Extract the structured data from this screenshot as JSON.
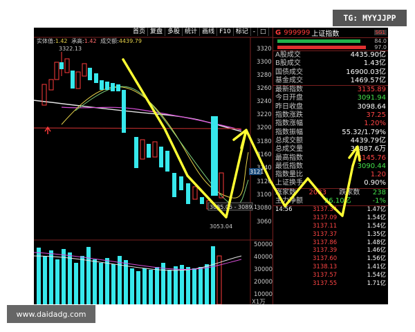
{
  "toolbar": {
    "items": [
      "首页",
      "复盘",
      "多股",
      "统计",
      "画线",
      "F10",
      "标记",
      "-",
      "□"
    ]
  },
  "legend": {
    "label1": "实体值:",
    "val1": "1.42",
    "label2": "承高:",
    "val2": "1.42",
    "label3": "成交额:",
    "val3": "4439.79"
  },
  "price_axis": {
    "ticks": [
      "3320",
      "3300",
      "3280",
      "3260",
      "3240",
      "3220",
      "3200",
      "3180",
      "3160",
      "3140",
      "3120",
      "3100",
      "3080",
      "3060"
    ]
  },
  "vol_axis": {
    "ticks": [
      "50000",
      "40000",
      "30000",
      "20000",
      "10000"
    ],
    "unit": "X1万"
  },
  "annotations": {
    "high": "3322.13",
    "low": "3053.04",
    "last_range": "3085.05 - 3089.1",
    "side_price": "3121"
  },
  "sidebar": {
    "g": "G",
    "code": "999999",
    "name": "上证指数",
    "sg": "SG1",
    "bar1_pct": "84.0",
    "bar2_pct": "97.0",
    "rows1": [
      {
        "k": "A股成交",
        "v": "4435.90亿"
      },
      {
        "k": "B股成交",
        "v": "1.43亿"
      },
      {
        "k": "国债成交",
        "v": "16900.03亿"
      },
      {
        "k": "基金成交",
        "v": "1469.57亿"
      }
    ],
    "rows2": [
      {
        "k": "最新指数",
        "v": "3135.89",
        "c": "red"
      },
      {
        "k": "今日开盘",
        "v": "3091.94",
        "c": "green"
      },
      {
        "k": "昨日收盘",
        "v": "3098.64",
        "c": ""
      },
      {
        "k": "指数涨跌",
        "v": "37.25",
        "c": "red"
      },
      {
        "k": "指数涨幅",
        "v": "1.20%",
        "c": "red"
      },
      {
        "k": "指数振幅",
        "v": "55.32/1.79%",
        "c": ""
      },
      {
        "k": "总成交额",
        "v": "4439.79亿",
        "c": ""
      },
      {
        "k": "总成交量",
        "v": "39887.6万",
        "c": ""
      },
      {
        "k": "最高指数",
        "v": "3145.76",
        "c": "red"
      },
      {
        "k": "最低指数",
        "v": "3090.44",
        "c": "green"
      },
      {
        "k": "指数量比",
        "v": "1.20",
        "c": "red"
      },
      {
        "k": "上证换手",
        "v": "0.90%",
        "c": ""
      }
    ],
    "rise_label": "涨家数",
    "rise": "2083",
    "fall_label": "跌家数",
    "fall": "238",
    "main_label": "主力净额",
    "main": "26.10亿",
    "main_pct": "-1%",
    "time": "14:56",
    "ticks": [
      {
        "p": "3137.34",
        "v": "1.47亿"
      },
      {
        "p": "3137.09",
        "v": "1.54亿"
      },
      {
        "p": "3137.11",
        "v": "1.54亿"
      },
      {
        "p": "3137.37",
        "v": "1.35亿"
      },
      {
        "p": "3137.86",
        "v": "1.48亿"
      },
      {
        "p": "3137.39",
        "v": "1.46亿"
      },
      {
        "p": "3137.60",
        "v": "1.56亿"
      },
      {
        "p": "3138.13",
        "v": "1.41亿"
      },
      {
        "p": "3137.57",
        "v": "1.54亿"
      },
      {
        "p": "3137.55",
        "v": "1.71亿"
      }
    ]
  },
  "badge": "TG: MYYJJPP",
  "watermark": "www.daidadg.com",
  "colors": {
    "up": "#ff3b3b",
    "down": "#37e8ec",
    "arrow": "#ffff33",
    "volume": "#37e8ec"
  }
}
